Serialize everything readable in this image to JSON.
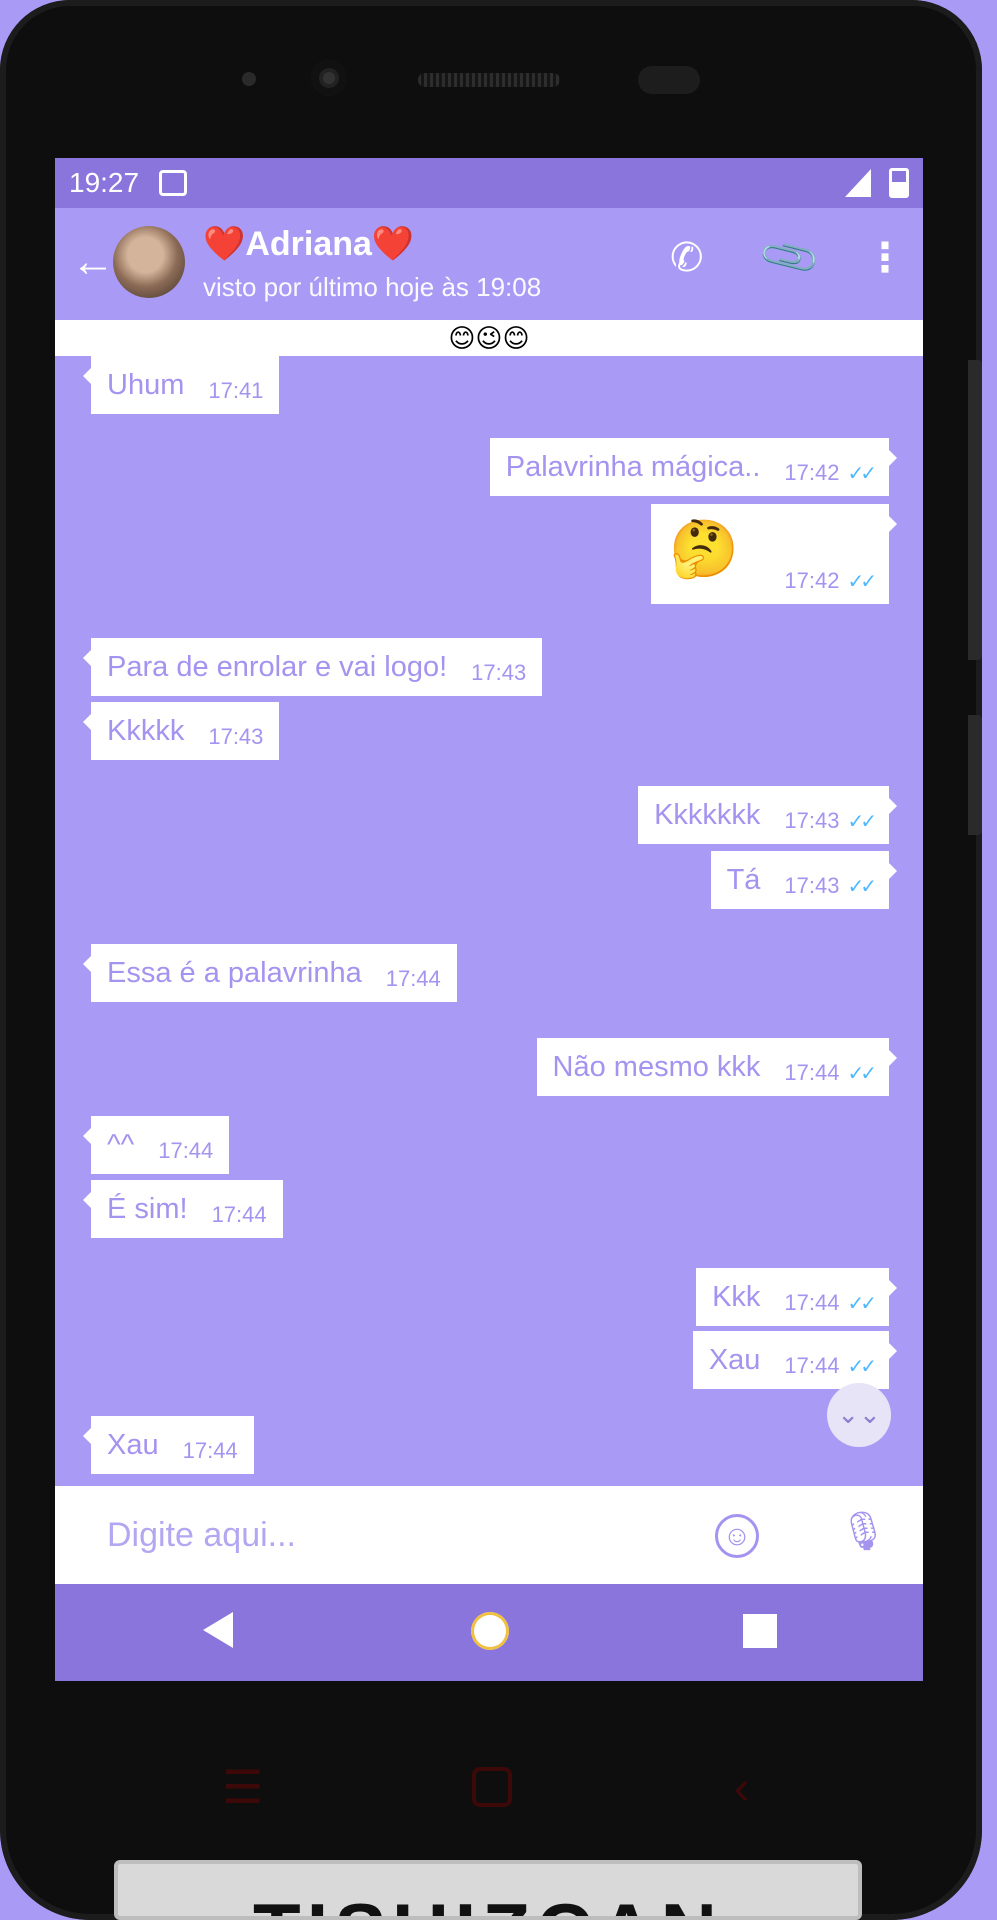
{
  "status_bar": {
    "time": "19:27"
  },
  "header": {
    "back_icon": "arrow-left-icon",
    "contact_name": "❤️Adriana❤️",
    "last_seen": "visto por último hoje às 19:08",
    "actions": [
      "phone-icon",
      "paperclip-icon",
      "more-vert-icon"
    ]
  },
  "banner": {
    "text": "😊😉😊"
  },
  "messages": [
    {
      "dir": "in",
      "text": "Uhum",
      "time": "17:41"
    },
    {
      "dir": "out",
      "text": "Palavrinha mágica..",
      "time": "17:42",
      "read": true
    },
    {
      "dir": "out",
      "text": "🤔",
      "time": "17:42",
      "read": true
    },
    {
      "dir": "in",
      "text": "Para de enrolar e vai logo!",
      "time": "17:43"
    },
    {
      "dir": "in",
      "text": "Kkkkk",
      "time": "17:43"
    },
    {
      "dir": "out",
      "text": "Kkkkkkk",
      "time": "17:43",
      "read": true
    },
    {
      "dir": "out",
      "text": "Tá",
      "time": "17:43",
      "read": true
    },
    {
      "dir": "in",
      "text": "Essa é a palavrinha",
      "time": "17:44"
    },
    {
      "dir": "out",
      "text": "Não mesmo kkk",
      "time": "17:44",
      "read": true
    },
    {
      "dir": "in",
      "text": "^^",
      "time": "17:44"
    },
    {
      "dir": "in",
      "text": "É sim!",
      "time": "17:44"
    },
    {
      "dir": "out",
      "text": "Kkk",
      "time": "17:44",
      "read": true
    },
    {
      "dir": "out",
      "text": "Xau",
      "time": "17:44",
      "read": true
    },
    {
      "dir": "in",
      "text": "Xau",
      "time": "17:44"
    }
  ],
  "read_mark": "✓✓",
  "input": {
    "placeholder": "Digite aqui..."
  },
  "watermark": "TISUIZCAN",
  "colors": {
    "accent": "#a99bf5",
    "status_bar": "#8a75dc",
    "bubble": "#ffffff",
    "bubble_text": "#a593f0",
    "read_tick": "#4fb8ff"
  }
}
